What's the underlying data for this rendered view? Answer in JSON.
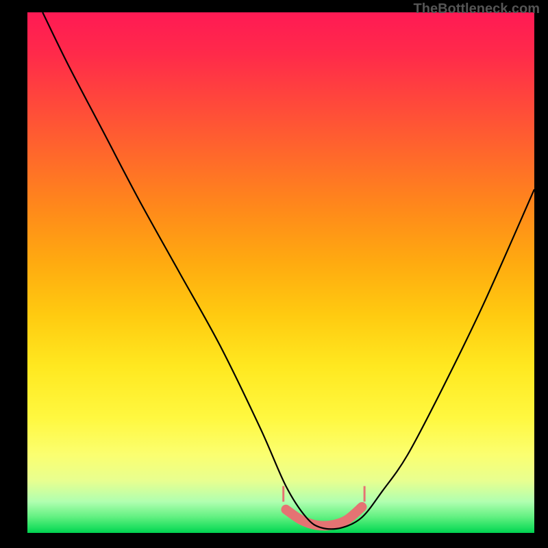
{
  "watermark": "TheBottleneck.com",
  "chart_data": {
    "type": "line",
    "title": "",
    "xlabel": "",
    "ylabel": "",
    "x_range": [
      0,
      100
    ],
    "y_range": [
      0,
      100
    ],
    "series": [
      {
        "name": "curve",
        "x": [
          3,
          8,
          15,
          22,
          30,
          38,
          46,
          51,
          55,
          58,
          62,
          66,
          70,
          75,
          82,
          90,
          100
        ],
        "values": [
          100,
          90,
          77,
          64,
          50,
          36,
          20,
          9,
          3,
          1,
          1,
          3,
          8,
          15,
          28,
          44,
          66
        ]
      }
    ],
    "highlight": {
      "name": "bottom-pink",
      "x": [
        51,
        54,
        57,
        60,
        63,
        66
      ],
      "values": [
        4.5,
        2.5,
        1.5,
        1.5,
        2.5,
        5
      ]
    },
    "annotations": []
  }
}
